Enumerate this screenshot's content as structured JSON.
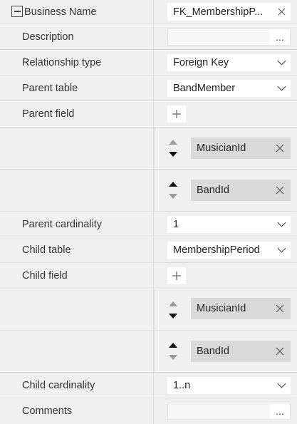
{
  "rows": {
    "business_name": {
      "label": "Business Name",
      "value": "FK_MembershipP..."
    },
    "description": {
      "label": "Description",
      "value": "",
      "dots": "..."
    },
    "relationship_type": {
      "label": "Relationship type",
      "value": "Foreign Key"
    },
    "parent_table": {
      "label": "Parent table",
      "value": "BandMember"
    },
    "parent_field": {
      "label": "Parent field",
      "fields": [
        "MusicianId",
        "BandId"
      ]
    },
    "parent_cardinality": {
      "label": "Parent cardinality",
      "value": "1"
    },
    "child_table": {
      "label": "Child table",
      "value": "MembershipPeriod"
    },
    "child_field": {
      "label": "Child field",
      "fields": [
        "MusicianId",
        "BandId"
      ]
    },
    "child_cardinality": {
      "label": "Child cardinality",
      "value": "1..n"
    },
    "comments": {
      "label": "Comments",
      "value": "",
      "dots": "..."
    }
  },
  "colors": {
    "chip_bg": "#d9d9d9",
    "panel_bg": "#f0f0f0",
    "input_bg": "#ffffff",
    "arrow_active": "#111111",
    "arrow_inactive": "#9a9a9a"
  }
}
